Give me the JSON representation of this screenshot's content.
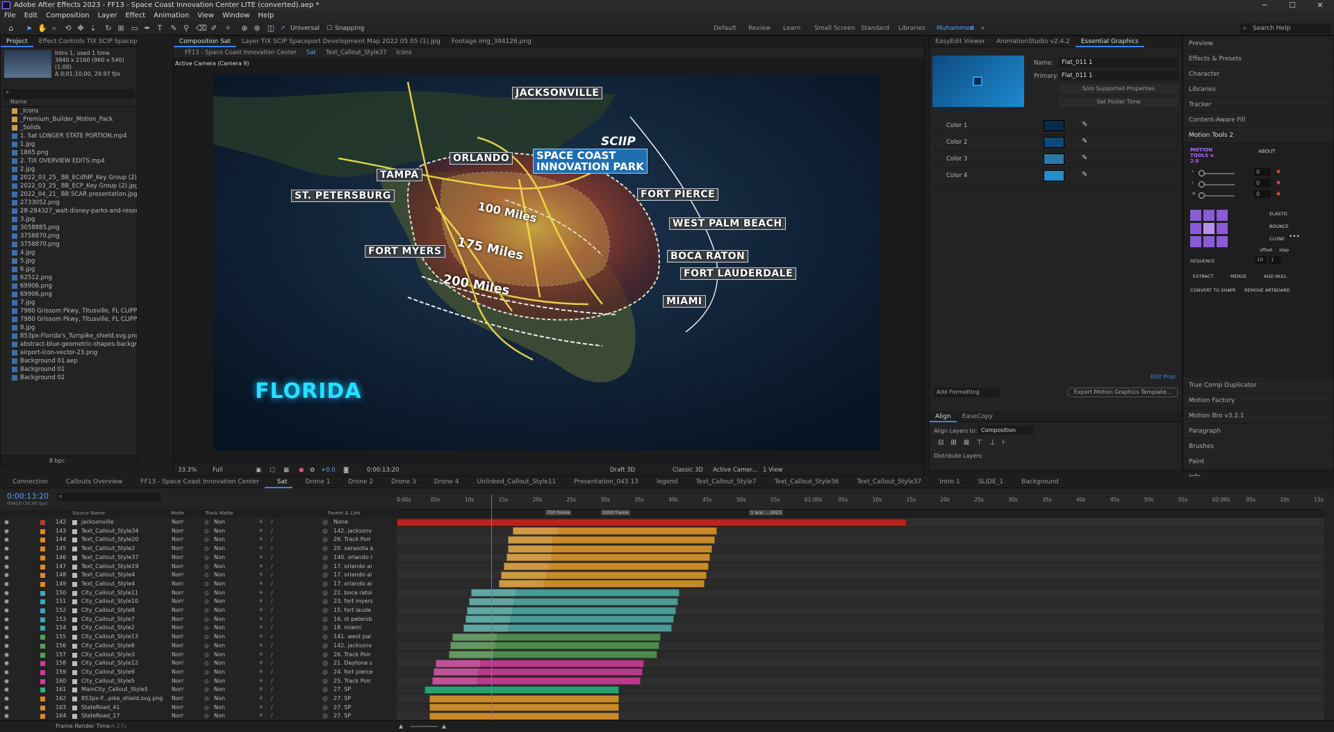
{
  "window": {
    "title": "Adobe After Effects 2023 - FF13 - Space Coast Innovation Center LITE (converted).aep *",
    "minimize": "─",
    "maximize": "☐",
    "close": "✕"
  },
  "menu": [
    "File",
    "Edit",
    "Composition",
    "Layer",
    "Effect",
    "Animation",
    "View",
    "Window",
    "Help"
  ],
  "toolbar": {
    "universal": "Universal",
    "snapping": "Snapping",
    "workspaces": [
      "Default",
      "Review",
      "Learn",
      "Small Screen",
      "Standard",
      "Libraries",
      "Muhammed"
    ],
    "search_placeholder": "Search Help"
  },
  "project": {
    "tabs": [
      "Project",
      "Effect Controls TIX SCIP Spacep"
    ],
    "preview": {
      "name": "Intro 1",
      "used": ", used 1 time",
      "size": "3840 x 2160  (960 x 540) (1.00)",
      "duration": "Δ 0;01;10;00, 29.97 fps"
    },
    "col_name": "Name",
    "search_placeholder": "",
    "files": [
      "_Icons",
      "_Premium_Builder_Motion_Pack",
      "_Solids",
      "1. Sat LONGER STATE PORTION.mp4",
      "1.jpg",
      "1865.png",
      "2. TIX OVERVIEW EDITS.mp4",
      "2.jpg",
      "2022_03_25_ BB_ECdfdP_Key Group (2).jpg",
      "2022_03_25_ BB_ECP_Key Group (2).jpg",
      "2022_04_21_ BB SCAR presentation.jpg",
      "2733052.png",
      "28-284327_walt-disney-parks-and-resorts-logo-walt-d",
      "3.jpg",
      "3058885.png",
      "3758870.png",
      "3758870.png",
      "4.jpg",
      "5.jpg",
      "6.jpg",
      "62512.png",
      "69906.png",
      "69906.png",
      "7.jpg",
      "7980 Grissom Pkwy, Titusville, FL CLIPPED.mp4",
      "7980 Grissom Pkwy, Titusville, FL CLIPPED.mp4",
      "8.jpg",
      "853px-Florida's_Turnpike_shield.svg.png",
      "abstract-blue-geometric-shapes-background.jpg",
      "airport-icon-vector-23.png",
      "Background 01.aep",
      "Background 01",
      "Background 02"
    ],
    "bpc": "8 bpc"
  },
  "comp": {
    "tabs": [
      "Composition Sat",
      "Layer TIX SCIP Spaceport Development Map 2022 05 05 (1).jpg",
      "Footage img_384126.png"
    ],
    "breadcrumbs": [
      "FF13 - Space Coast Innovation Center",
      "Sat",
      "Text_Callout_Style37",
      "Icons"
    ],
    "camera": "Active Camera (Camera 9)",
    "zoom": "33.3%",
    "quality": "Full",
    "exposure": "+0.0",
    "timecode": "0:00:13:20",
    "renderer": "Draft 3D",
    "classic": "Classic 3D",
    "active_cam": "Active Camer...",
    "views": "1 View"
  },
  "map": {
    "state": "FLORIDA",
    "logo": "SCIIP",
    "cities": [
      "JACKSONVILLE",
      "ORLANDO",
      "TAMPA",
      "ST. PETERSBURG",
      "FORT MYERS",
      "FORT PIERCE",
      "WEST PALM BEACH",
      "BOCA RATON",
      "FORT LAUDERDALE",
      "MIAMI"
    ],
    "park": [
      "SPACE COAST",
      "INNOVATION PARK"
    ],
    "rings": [
      "100 Miles",
      "175 Miles",
      "200 Miles"
    ]
  },
  "essential": {
    "tabs": [
      "EasyEdit Viewer",
      "AnimationStudio v2.4.2",
      "Essential Graphics"
    ],
    "name_label": "Name:",
    "name_value": "Flat_011 1",
    "primary_label": "Primary:",
    "primary_value": "Flat_011 1",
    "solo": "Solo Supported Properties",
    "poster": "Set Poster Time",
    "colors": [
      "Color 1",
      "Color 2",
      "Color 3",
      "Color 4"
    ],
    "color_values": [
      "#0a2a4a",
      "#0b4a7a",
      "#2a7aa8",
      "#1e90d0"
    ],
    "edit_prop": "Edit Prop",
    "add_formatting": "Add Formatting",
    "export": "Export Motion Graphics Template...",
    "align_tabs": [
      "Align",
      "EaseCopy"
    ],
    "align_to_label": "Align Layers to:",
    "align_to": "Composition",
    "distribute": "Distribute Layers:"
  },
  "side": {
    "items": [
      "Preview",
      "Effects & Presets",
      "Character",
      "Libraries",
      "Tracker",
      "Content-Aware Fill",
      "Motion Tools 2"
    ],
    "motion": {
      "title": "MOTION TOOLS v. 2.0",
      "about": "ABOUT",
      "vals": [
        "0",
        "0",
        "0"
      ],
      "elastic": "ELASTIC",
      "bounce": "BOUNCE",
      "clone": "CLONE",
      "offset": "offset",
      "step": "step",
      "sequence": "SEQUENCE",
      "seq_vals": [
        "10",
        "1"
      ],
      "extract": "EXTRACT",
      "merge": "MERGE",
      "add_null": "ADD NULL",
      "convert": "CONVERT TO SHAPE",
      "remove": "REMOVE ARTBOARD"
    },
    "lower": [
      "True Comp Duplicator",
      "Motion Factory",
      "Motion Bro v3.2.1",
      "Paragraph",
      "Brushes",
      "Paint",
      "Info"
    ]
  },
  "timeline": {
    "tabs": [
      "Connection",
      "Callouts Overview",
      "FF13 - Space Coast Innovation Center",
      "Sat",
      "Drone 1",
      "Drone 2",
      "Drone 3",
      "Drone 4",
      "Unlinked_Callout_Style11",
      "Presentation_043 13",
      "legend",
      "Text_Callout_Style7",
      "Text_Callout_Style36",
      "Text_Callout_Style37",
      "Intro 1",
      "SLIDE_1",
      "Background"
    ],
    "timecode": "0:00:13:20",
    "frames": "00410 (30.00 fps)",
    "headers": {
      "source": "Source Name",
      "mode": "Mode",
      "track": "Track Matte",
      "parent": "Parent & Link"
    },
    "ruler": [
      "0:00s",
      "05s",
      "10s",
      "15s",
      "20s",
      "25s",
      "30s",
      "35s",
      "40s",
      "45s",
      "50s",
      "55s",
      "01:00s",
      "05s",
      "10s",
      "15s",
      "20s",
      "25s",
      "30s",
      "35s",
      "40s",
      "45s",
      "50s",
      "55s",
      "02:00s",
      "05s",
      "10s",
      "15s"
    ],
    "markers": [
      "700 frame",
      "1000 frame",
      "1 ace ... 2023"
    ],
    "layers": [
      {
        "n": "142",
        "name": "jacksonville",
        "mode": "Norr",
        "matte": "Non",
        "parent": "None",
        "color": "#c0392b",
        "bar": "#b5241f",
        "b0": 0.0,
        "b1": 0.55,
        "b2": 0
      },
      {
        "n": "143",
        "name": "Text_Callout_Style34",
        "mode": "Norr",
        "matte": "Non",
        "parent": "142. jacksonv",
        "color": "#e08a1e",
        "bar": "#c98a2a",
        "b0": 0.125,
        "b1": 0.345,
        "b2": 0.16
      },
      {
        "n": "144",
        "name": "Text_Callout_Style20",
        "mode": "Norr",
        "matte": "Non",
        "parent": "26. Track Poir",
        "color": "#e08a1e",
        "bar": "#c98a2a",
        "b0": 0.12,
        "b1": 0.343,
        "b2": 0.16
      },
      {
        "n": "145",
        "name": "Text_Callout_Style2",
        "mode": "Norr",
        "matte": "Non",
        "parent": "20. sarasota a",
        "color": "#e08a1e",
        "bar": "#c98a2a",
        "b0": 0.12,
        "b1": 0.34,
        "b2": 0.16
      },
      {
        "n": "146",
        "name": "Text_Callout_Style37",
        "mode": "Norr",
        "matte": "Non",
        "parent": "140. orlando r",
        "color": "#e08a1e",
        "bar": "#c98a2a",
        "b0": 0.118,
        "b1": 0.338,
        "b2": 0.16
      },
      {
        "n": "147",
        "name": "Text_Callout_Style19",
        "mode": "Norr",
        "matte": "Non",
        "parent": "17. orlando ai",
        "color": "#e08a1e",
        "bar": "#c98a2a",
        "b0": 0.115,
        "b1": 0.336,
        "b2": 0.16
      },
      {
        "n": "148",
        "name": "Text_Callout_Style4",
        "mode": "Norr",
        "matte": "Non",
        "parent": "17. orlando ai",
        "color": "#e08a1e",
        "bar": "#c98a2a",
        "b0": 0.112,
        "b1": 0.334,
        "b2": 0.16
      },
      {
        "n": "149",
        "name": "Text_Callout_Style4",
        "mode": "Norr",
        "matte": "Non",
        "parent": "17. orlando ai",
        "color": "#e08a1e",
        "bar": "#c98a2a",
        "b0": 0.11,
        "b1": 0.332,
        "b2": 0.16
      },
      {
        "n": "150",
        "name": "City_Callout_Style11",
        "mode": "Norr",
        "matte": "Non",
        "parent": "22. boca ratoi",
        "color": "#3aa8b8",
        "bar": "#4a9a95",
        "b0": 0.08,
        "b1": 0.305,
        "b2": 0.16
      },
      {
        "n": "151",
        "name": "City_Callout_Style10",
        "mode": "Norr",
        "matte": "Non",
        "parent": "23. fort myers",
        "color": "#3aa8b8",
        "bar": "#4a9a95",
        "b0": 0.078,
        "b1": 0.303,
        "b2": 0.16
      },
      {
        "n": "152",
        "name": "City_Callout_Style8",
        "mode": "Norr",
        "matte": "Non",
        "parent": "15. fort laude",
        "color": "#3aa8b8",
        "bar": "#4a9a95",
        "b0": 0.076,
        "b1": 0.301,
        "b2": 0.16
      },
      {
        "n": "153",
        "name": "City_Callout_Style7",
        "mode": "Norr",
        "matte": "Non",
        "parent": "16. st petersb",
        "color": "#3aa8b8",
        "bar": "#4a9a95",
        "b0": 0.074,
        "b1": 0.299,
        "b2": 0.16
      },
      {
        "n": "154",
        "name": "City_Callout_Style2",
        "mode": "Norr",
        "matte": "Non",
        "parent": "18. miami",
        "color": "#3aa8b8",
        "bar": "#4a9a95",
        "b0": 0.072,
        "b1": 0.297,
        "b2": 0.16
      },
      {
        "n": "155",
        "name": "City_Callout_Style13",
        "mode": "Norr",
        "matte": "Non",
        "parent": "141. west pal",
        "color": "#5aa05a",
        "bar": "#4e8a4e",
        "b0": 0.06,
        "b1": 0.285,
        "b2": 0.16
      },
      {
        "n": "156",
        "name": "City_Callout_Style6",
        "mode": "Norr",
        "matte": "Non",
        "parent": "142. jacksonv",
        "color": "#5aa05a",
        "bar": "#4e8a4e",
        "b0": 0.058,
        "b1": 0.283,
        "b2": 0.16
      },
      {
        "n": "157",
        "name": "City_Callout_Style3",
        "mode": "Norr",
        "matte": "Non",
        "parent": "26. Track Poir",
        "color": "#5aa05a",
        "bar": "#4e8a4e",
        "b0": 0.056,
        "b1": 0.281,
        "b2": 0.16
      },
      {
        "n": "158",
        "name": "City_Callout_Style12",
        "mode": "Norr",
        "matte": "Non",
        "parent": "21. Daytona s",
        "color": "#d43a9a",
        "bar": "#b83a8a",
        "b0": 0.042,
        "b1": 0.267,
        "b2": 0.16
      },
      {
        "n": "159",
        "name": "City_Callout_Style9",
        "mode": "Norr",
        "matte": "Non",
        "parent": "24. fort pierce",
        "color": "#d43a9a",
        "bar": "#b83a8a",
        "b0": 0.04,
        "b1": 0.265,
        "b2": 0.16
      },
      {
        "n": "160",
        "name": "City_Callout_Style5",
        "mode": "Norr",
        "matte": "Non",
        "parent": "25. Track Poir",
        "color": "#d43a9a",
        "bar": "#b83a8a",
        "b0": 0.038,
        "b1": 0.263,
        "b2": 0.16
      },
      {
        "n": "161",
        "name": "MainCity_Callout_Style5",
        "mode": "Norr",
        "matte": "Non",
        "parent": "27. SP",
        "color": "#2ab87a",
        "bar": "#28a070",
        "b0": 0.03,
        "b1": 0.24,
        "b2": 0
      },
      {
        "n": "162",
        "name": "853px-F...pike_shield.svg.png",
        "mode": "Norr",
        "matte": "Non",
        "parent": "27. SP",
        "color": "#e08a1e",
        "bar": "#c98a2a",
        "b0": 0.035,
        "b1": 0.24,
        "b2": 0
      },
      {
        "n": "163",
        "name": "StateRoad_41",
        "mode": "Norr",
        "matte": "Non",
        "parent": "27. SP",
        "color": "#e08a1e",
        "bar": "#c98a2a",
        "b0": 0.035,
        "b1": 0.24,
        "b2": 0
      },
      {
        "n": "164",
        "name": "StateRoad_17",
        "mode": "Norr",
        "matte": "Non",
        "parent": "27. SP",
        "color": "#e08a1e",
        "bar": "#c98a2a",
        "b0": 0.035,
        "b1": 0.24,
        "b2": 0
      }
    ],
    "render_time_label": "Frame Render Time:",
    "render_time": "4.27s"
  }
}
